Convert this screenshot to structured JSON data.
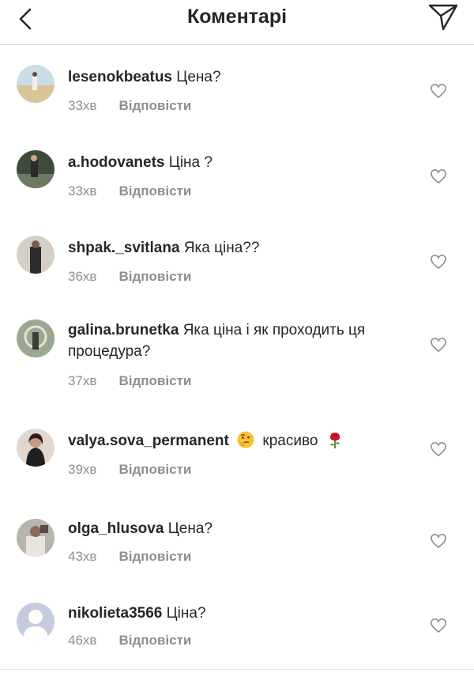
{
  "header": {
    "title": "Коментарі"
  },
  "reply_label": "Відповісти",
  "comments": [
    {
      "username": "lesenokbeatus",
      "text": "Цена?",
      "time": "33хв"
    },
    {
      "username": "a.hodovanets",
      "text": "Ціна ?",
      "time": "33хв"
    },
    {
      "username": "shpak._svitlana",
      "text": "Яка ціна??",
      "time": "36хв"
    },
    {
      "username": "galina.brunetka",
      "text": "Яка ціна і як проходить ця процедура?",
      "time": "37хв"
    },
    {
      "username": "valya.sova_permanent",
      "text_after": "красиво",
      "time": "39хв"
    },
    {
      "username": "olga_hlusova",
      "text": "Цена?",
      "time": "43хв"
    },
    {
      "username": "nikolieta3566",
      "text": "Ціна?",
      "time": "46хв"
    }
  ],
  "icons": {
    "back": "chevron-left-icon",
    "send": "paper-plane-icon",
    "like": "heart-outline-icon",
    "thinking_emoji": "thinking-face-emoji",
    "rose_emoji": "rose-emoji"
  },
  "colors": {
    "text": "#262626",
    "secondary": "#8e8e8e",
    "divider": "#dbdbdb"
  }
}
